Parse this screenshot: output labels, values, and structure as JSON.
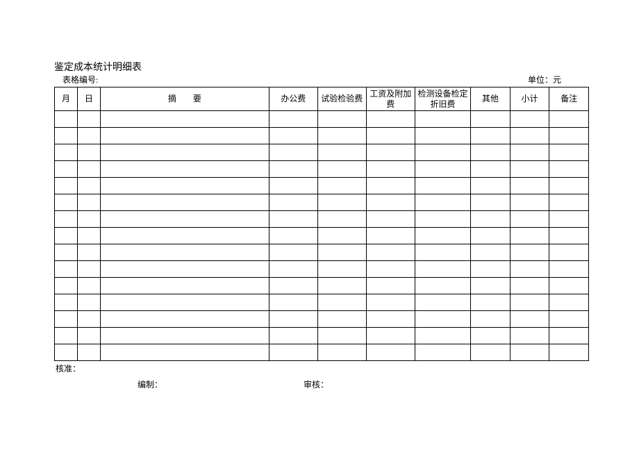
{
  "title": "鉴定成本统计明细表",
  "form_no_label": "表格编号:",
  "unit_label": "单位：元",
  "headers": {
    "month": "月",
    "day": "日",
    "summary": "摘　　要",
    "office_fee": "办公费",
    "test_fee": "试验检验费",
    "wage_fee": "工资及附加费",
    "depreciation_fee": "检测设备检定折旧费",
    "other": "其他",
    "subtotal": "小计",
    "remark": "备注"
  },
  "footer": {
    "approve": "核准：",
    "prepare": "编制：",
    "audit": "审核："
  },
  "row_count": 15
}
